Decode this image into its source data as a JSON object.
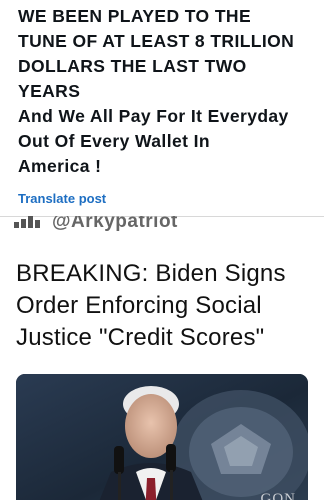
{
  "post": {
    "lines": [
      "WE BEEN PLAYED TO THE",
      "TUNE OF AT LEAST 8 TRILLION",
      "DOLLARS THE LAST TWO",
      "YEARS",
      "And We All Pay For It Everyday",
      "Out Of Every Wallet In",
      "America !"
    ],
    "translate_label": "Translate post"
  },
  "embedded": {
    "handle": "@Arkypatriot",
    "headline_lines": [
      "BREAKING: Biden Signs",
      "Order Enforcing Social",
      "Justice \"Credit Scores\""
    ],
    "photo_caption": "GON",
    "photo_icon": "news-photo"
  },
  "colors": {
    "link": "#1d6ec2",
    "text": "#0f1419"
  }
}
